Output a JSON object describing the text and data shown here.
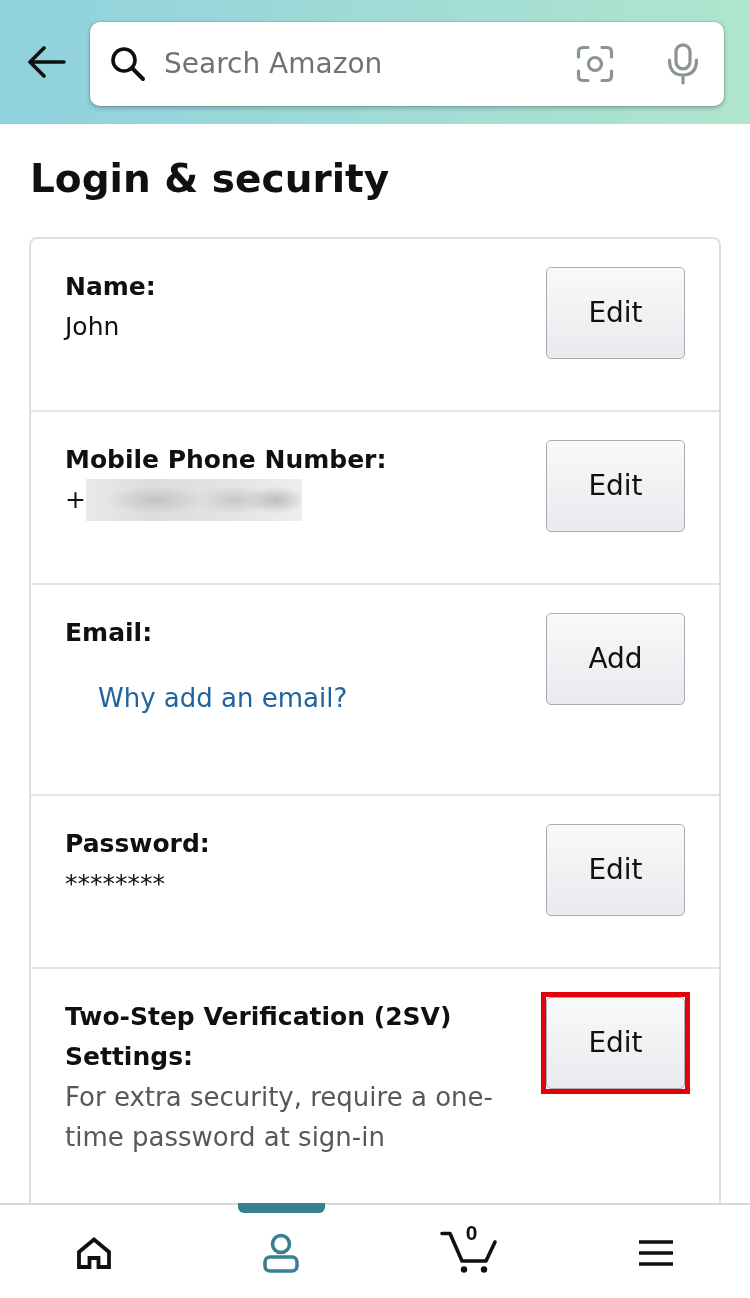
{
  "search": {
    "placeholder": "Search Amazon"
  },
  "title": "Login & security",
  "rows": [
    {
      "label": "Name:",
      "value": "John",
      "button": "Edit",
      "highlighted": false
    },
    {
      "label": "Mobile Phone Number:",
      "value": "+",
      "redacted": true,
      "button": "Edit",
      "highlighted": false
    },
    {
      "label": "Email:",
      "link": "Why add an email?",
      "button": "Add",
      "highlighted": false
    },
    {
      "label": "Password:",
      "value": "********",
      "button": "Edit",
      "highlighted": false
    },
    {
      "label": "Two-Step Verification (2SV) Settings:",
      "description": "For extra security, require a one-time password at sign-in",
      "button": "Edit",
      "highlighted": true
    }
  ],
  "nav": [
    {
      "kind": "home",
      "selected": false
    },
    {
      "kind": "account",
      "selected": true
    },
    {
      "kind": "cart",
      "selected": false,
      "count": "0"
    },
    {
      "kind": "menu",
      "selected": false
    }
  ]
}
